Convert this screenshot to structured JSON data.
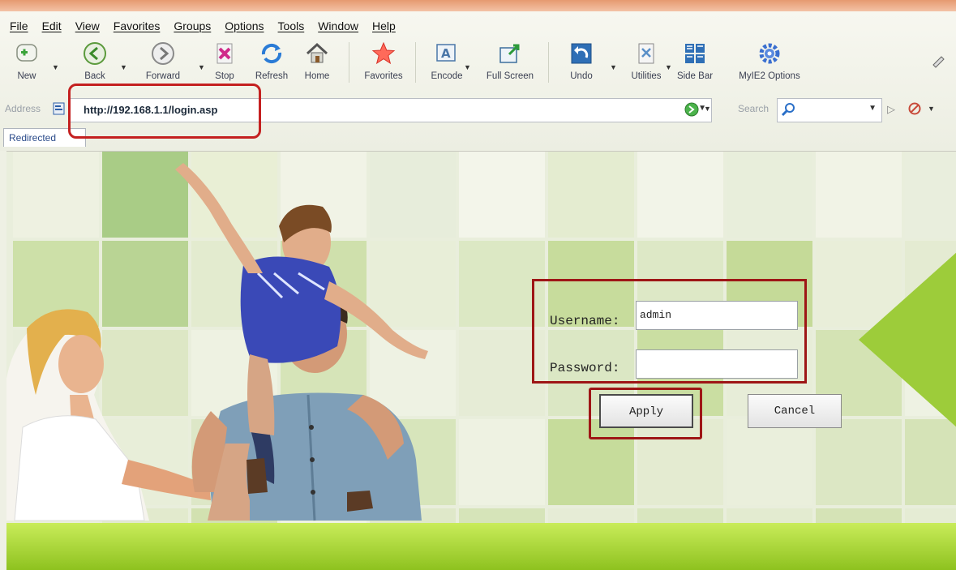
{
  "menu": {
    "items": [
      "File",
      "Edit",
      "View",
      "Favorites",
      "Groups",
      "Options",
      "Tools",
      "Window",
      "Help"
    ]
  },
  "toolbar": {
    "buttons": [
      {
        "label": "New",
        "icon": "new-page-icon"
      },
      {
        "label": "Back",
        "icon": "back-arrow-icon"
      },
      {
        "label": "Forward",
        "icon": "forward-arrow-icon"
      },
      {
        "label": "Stop",
        "icon": "stop-icon"
      },
      {
        "label": "Refresh",
        "icon": "refresh-icon"
      },
      {
        "label": "Home",
        "icon": "home-icon"
      },
      {
        "label": "Favorites",
        "icon": "star-icon"
      },
      {
        "label": "Encode",
        "icon": "encode-icon"
      },
      {
        "label": "Full Screen",
        "icon": "full-screen-icon"
      },
      {
        "label": "Undo",
        "icon": "undo-icon"
      },
      {
        "label": "Utilities",
        "icon": "utilities-icon"
      },
      {
        "label": "Side Bar",
        "icon": "side-bar-icon"
      },
      {
        "label": "MyIE2 Options",
        "icon": "gear-icon"
      }
    ]
  },
  "address": {
    "label": "Address",
    "url": "http://192.168.1.1/login.asp"
  },
  "search": {
    "label": "Search"
  },
  "tab": {
    "label": "Redirected"
  },
  "login": {
    "username_label": "Username:",
    "username_value": "admin",
    "password_label": "Password:",
    "password_value": "",
    "apply_label": "Apply",
    "cancel_label": "Cancel"
  },
  "colors": {
    "highlight": "#c42020",
    "page_green": "#9dcc3a"
  }
}
